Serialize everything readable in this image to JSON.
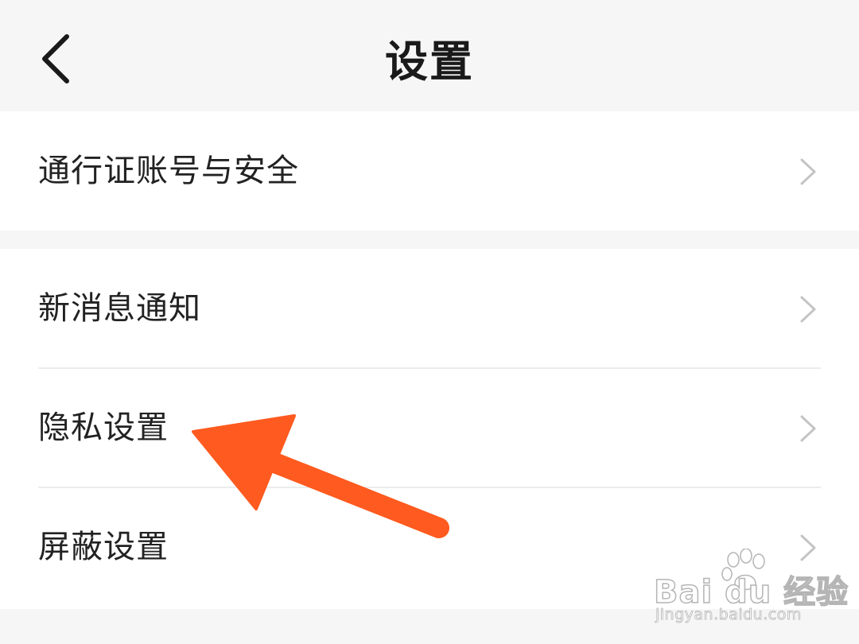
{
  "header": {
    "title": "设置",
    "back_icon": "chevron-left-icon"
  },
  "settings_groups": [
    {
      "items": [
        {
          "label": "通行证账号与安全",
          "icon": "chevron-right-icon"
        }
      ]
    },
    {
      "items": [
        {
          "label": "新消息通知",
          "icon": "chevron-right-icon"
        },
        {
          "label": "隐私设置",
          "icon": "chevron-right-icon"
        },
        {
          "label": "屏蔽设置",
          "icon": "chevron-right-icon"
        }
      ]
    }
  ],
  "annotation": {
    "type": "arrow",
    "color": "#ff5a1f",
    "points_to": "隐私设置"
  },
  "watermark": {
    "brand": "Bai du 经验",
    "url": "jingyan.baidu.com"
  },
  "colors": {
    "background": "#f6f6f6",
    "card": "#ffffff",
    "text": "#222222",
    "chevron": "#c4c4c4",
    "divider": "#ececec",
    "arrow": "#ff5a1f"
  }
}
